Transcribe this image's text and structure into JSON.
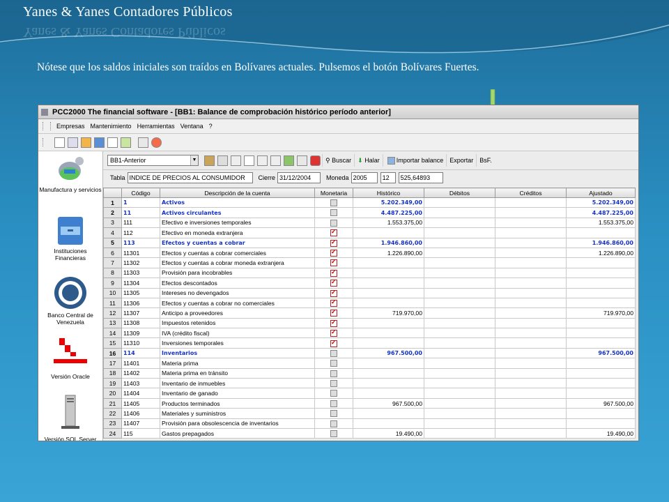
{
  "slide": {
    "title": "Yanes & Yanes Contadores Públicos",
    "caption": "Nótese que los saldos iniciales son traídos en Bolívares actuales. Pulsemos el botón Bolívares Fuertes."
  },
  "window": {
    "title": "PCC2000 The financial software - [BB1: Balance de comprobación histórico período anterior]",
    "menu": [
      "Empresas",
      "Mantenimiento",
      "Herramientas",
      "Ventana",
      "?"
    ]
  },
  "sidebar": [
    {
      "label": "Manufactura y servicios",
      "icon": "helmet-gear-icon"
    },
    {
      "label": "Instituciones Financieras",
      "icon": "filing-cabinet-icon"
    },
    {
      "label": "Banco Central de Venezuela",
      "icon": "bcv-seal-icon"
    },
    {
      "label": "Versión Oracle",
      "icon": "oracle-logo-icon"
    },
    {
      "label": "Versión SQL Server",
      "icon": "server-tower-icon"
    }
  ],
  "toolbar": {
    "combo_value": "BB1-Anterior",
    "buscar": "Buscar",
    "halar": "Halar",
    "importar": "Importar balance",
    "exportar": "Exportar",
    "bsf": "BsF."
  },
  "filters": {
    "tabla_label": "Tabla",
    "tabla_value": "INDICE DE PRECIOS AL CONSUMIDOR",
    "cierre_label": "Cierre",
    "cierre_value": "31/12/2004",
    "moneda_label": "Moneda",
    "moneda_year": "2005",
    "moneda_month": "12",
    "moneda_value": "525,64893"
  },
  "grid": {
    "columns": [
      "Código",
      "Descripción de la cuenta",
      "Monetaria",
      "Histórico",
      "Débitos",
      "Créditos",
      "Ajustado"
    ],
    "rows": [
      {
        "n": "1",
        "code": "1",
        "desc": "Activos",
        "mon": false,
        "hist": "5.202.349,00",
        "adj": "5.202.349,00",
        "bold": true
      },
      {
        "n": "2",
        "code": "11",
        "desc": "Activos circulantes",
        "mon": false,
        "hist": "4.487.225,00",
        "adj": "4.487.225,00",
        "bold": true
      },
      {
        "n": "3",
        "code": "111",
        "desc": "Efectivo e inversiones temporales",
        "mon": false,
        "hist": "1.553.375,00",
        "adj": "1.553.375,00",
        "bold": false
      },
      {
        "n": "4",
        "code": "112",
        "desc": "Efectivo en moneda extranjera",
        "mon": true,
        "hist": "",
        "adj": "",
        "bold": false
      },
      {
        "n": "5",
        "code": "113",
        "desc": "Efectos y cuentas a cobrar",
        "mon": true,
        "hist": "1.946.860,00",
        "adj": "1.946.860,00",
        "bold": true
      },
      {
        "n": "6",
        "code": "11301",
        "desc": "Efectos y cuentas a cobrar comerciales",
        "mon": true,
        "hist": "1.226.890,00",
        "adj": "1.226.890,00",
        "bold": false
      },
      {
        "n": "7",
        "code": "11302",
        "desc": "Efectos y cuentas a cobrar moneda extranjera",
        "mon": true,
        "hist": "",
        "adj": "",
        "bold": false
      },
      {
        "n": "8",
        "code": "11303",
        "desc": "Provisión para incobrables",
        "mon": true,
        "hist": "",
        "adj": "",
        "bold": false
      },
      {
        "n": "9",
        "code": "11304",
        "desc": "Efectos descontados",
        "mon": true,
        "hist": "",
        "adj": "",
        "bold": false
      },
      {
        "n": "10",
        "code": "11305",
        "desc": "Intereses no devengados",
        "mon": true,
        "hist": "",
        "adj": "",
        "bold": false
      },
      {
        "n": "11",
        "code": "11306",
        "desc": "Efectos y cuentas a cobrar no comerciales",
        "mon": true,
        "hist": "",
        "adj": "",
        "bold": false
      },
      {
        "n": "12",
        "code": "11307",
        "desc": "Anticipo a proveedores",
        "mon": true,
        "hist": "719.970,00",
        "adj": "719.970,00",
        "bold": false
      },
      {
        "n": "13",
        "code": "11308",
        "desc": "Impuestos retenidos",
        "mon": true,
        "hist": "",
        "adj": "",
        "bold": false
      },
      {
        "n": "14",
        "code": "11309",
        "desc": "IVA (crédito fiscal)",
        "mon": true,
        "hist": "",
        "adj": "",
        "bold": false
      },
      {
        "n": "15",
        "code": "11310",
        "desc": "Inversiones temporales",
        "mon": true,
        "hist": "",
        "adj": "",
        "bold": false
      },
      {
        "n": "16",
        "code": "114",
        "desc": "Inventarios",
        "mon": false,
        "hist": "967.500,00",
        "adj": "967.500,00",
        "bold": true
      },
      {
        "n": "17",
        "code": "11401",
        "desc": "Materia prima",
        "mon": false,
        "hist": "",
        "adj": "",
        "bold": false
      },
      {
        "n": "18",
        "code": "11402",
        "desc": "Materia prima en tránsito",
        "mon": false,
        "hist": "",
        "adj": "",
        "bold": false
      },
      {
        "n": "19",
        "code": "11403",
        "desc": "Inventario de inmuebles",
        "mon": false,
        "hist": "",
        "adj": "",
        "bold": false
      },
      {
        "n": "20",
        "code": "11404",
        "desc": "Inventario de ganado",
        "mon": false,
        "hist": "",
        "adj": "",
        "bold": false
      },
      {
        "n": "21",
        "code": "11405",
        "desc": "Productos terminados",
        "mon": false,
        "hist": "967.500,00",
        "adj": "967.500,00",
        "bold": false
      },
      {
        "n": "22",
        "code": "11406",
        "desc": "Materiales y suministros",
        "mon": false,
        "hist": "",
        "adj": "",
        "bold": false
      },
      {
        "n": "23",
        "code": "11407",
        "desc": "Provisión para obsolescencia de inventarios",
        "mon": false,
        "hist": "",
        "adj": "",
        "bold": false
      },
      {
        "n": "24",
        "code": "115",
        "desc": "Gastos prepagados",
        "mon": false,
        "hist": "19.490,00",
        "adj": "19.490,00",
        "bold": false
      }
    ]
  },
  "colors": {
    "accent_blue": "#1432c8",
    "slide_bg": "#2a8fc2",
    "arrow": "#a4d86e"
  }
}
